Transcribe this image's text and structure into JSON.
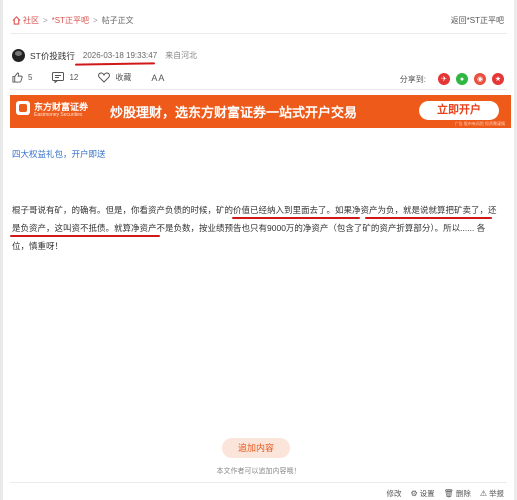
{
  "breadcrumb": {
    "home": "社区",
    "forum": "*ST正平吧",
    "current": "帖子正文"
  },
  "back_link": "返回*ST正平吧",
  "post": {
    "author": "ST价投践行",
    "time": "2026-03-18 19:33:47",
    "location": "来自河北"
  },
  "actions": {
    "likes": "5",
    "comments": "12",
    "favorite": "收藏",
    "font_size": "AA"
  },
  "share": {
    "label": "分享到:"
  },
  "banner": {
    "brand": "东方财富证券",
    "brand_en": "Eastmoney Securities",
    "slogan": "炒股理财，选东方财富证券一站式开户交易",
    "cta": "立即开户",
    "fine_print": "广告 股市有风险 投资需谨慎"
  },
  "promo_link": "四大权益礼包，开户即送",
  "content": {
    "p1": "棍子哥说有矿，的确有。但是，你看资产负债的时候，",
    "p2": "矿的价值已经纳入到里面去了。",
    "p3": "如果净资产为负，就是说就算把矿卖了，还是负资产，这叫资不抵债。",
    "p4": "就算净资产不是负数，按业绩预告也只有9000万的净资产（包含了矿的资产折算部分）。所以...... 各位，慎重呀！"
  },
  "add_button": "追加内容",
  "add_note": "本文作者可以追加内容哦！",
  "footer": {
    "edit": "修改",
    "settings": "设置",
    "delete": "删除",
    "report": "举报"
  },
  "colors": {
    "accent": "#ee5a1a",
    "link": "#3371c9",
    "annotation": "#d01818"
  }
}
